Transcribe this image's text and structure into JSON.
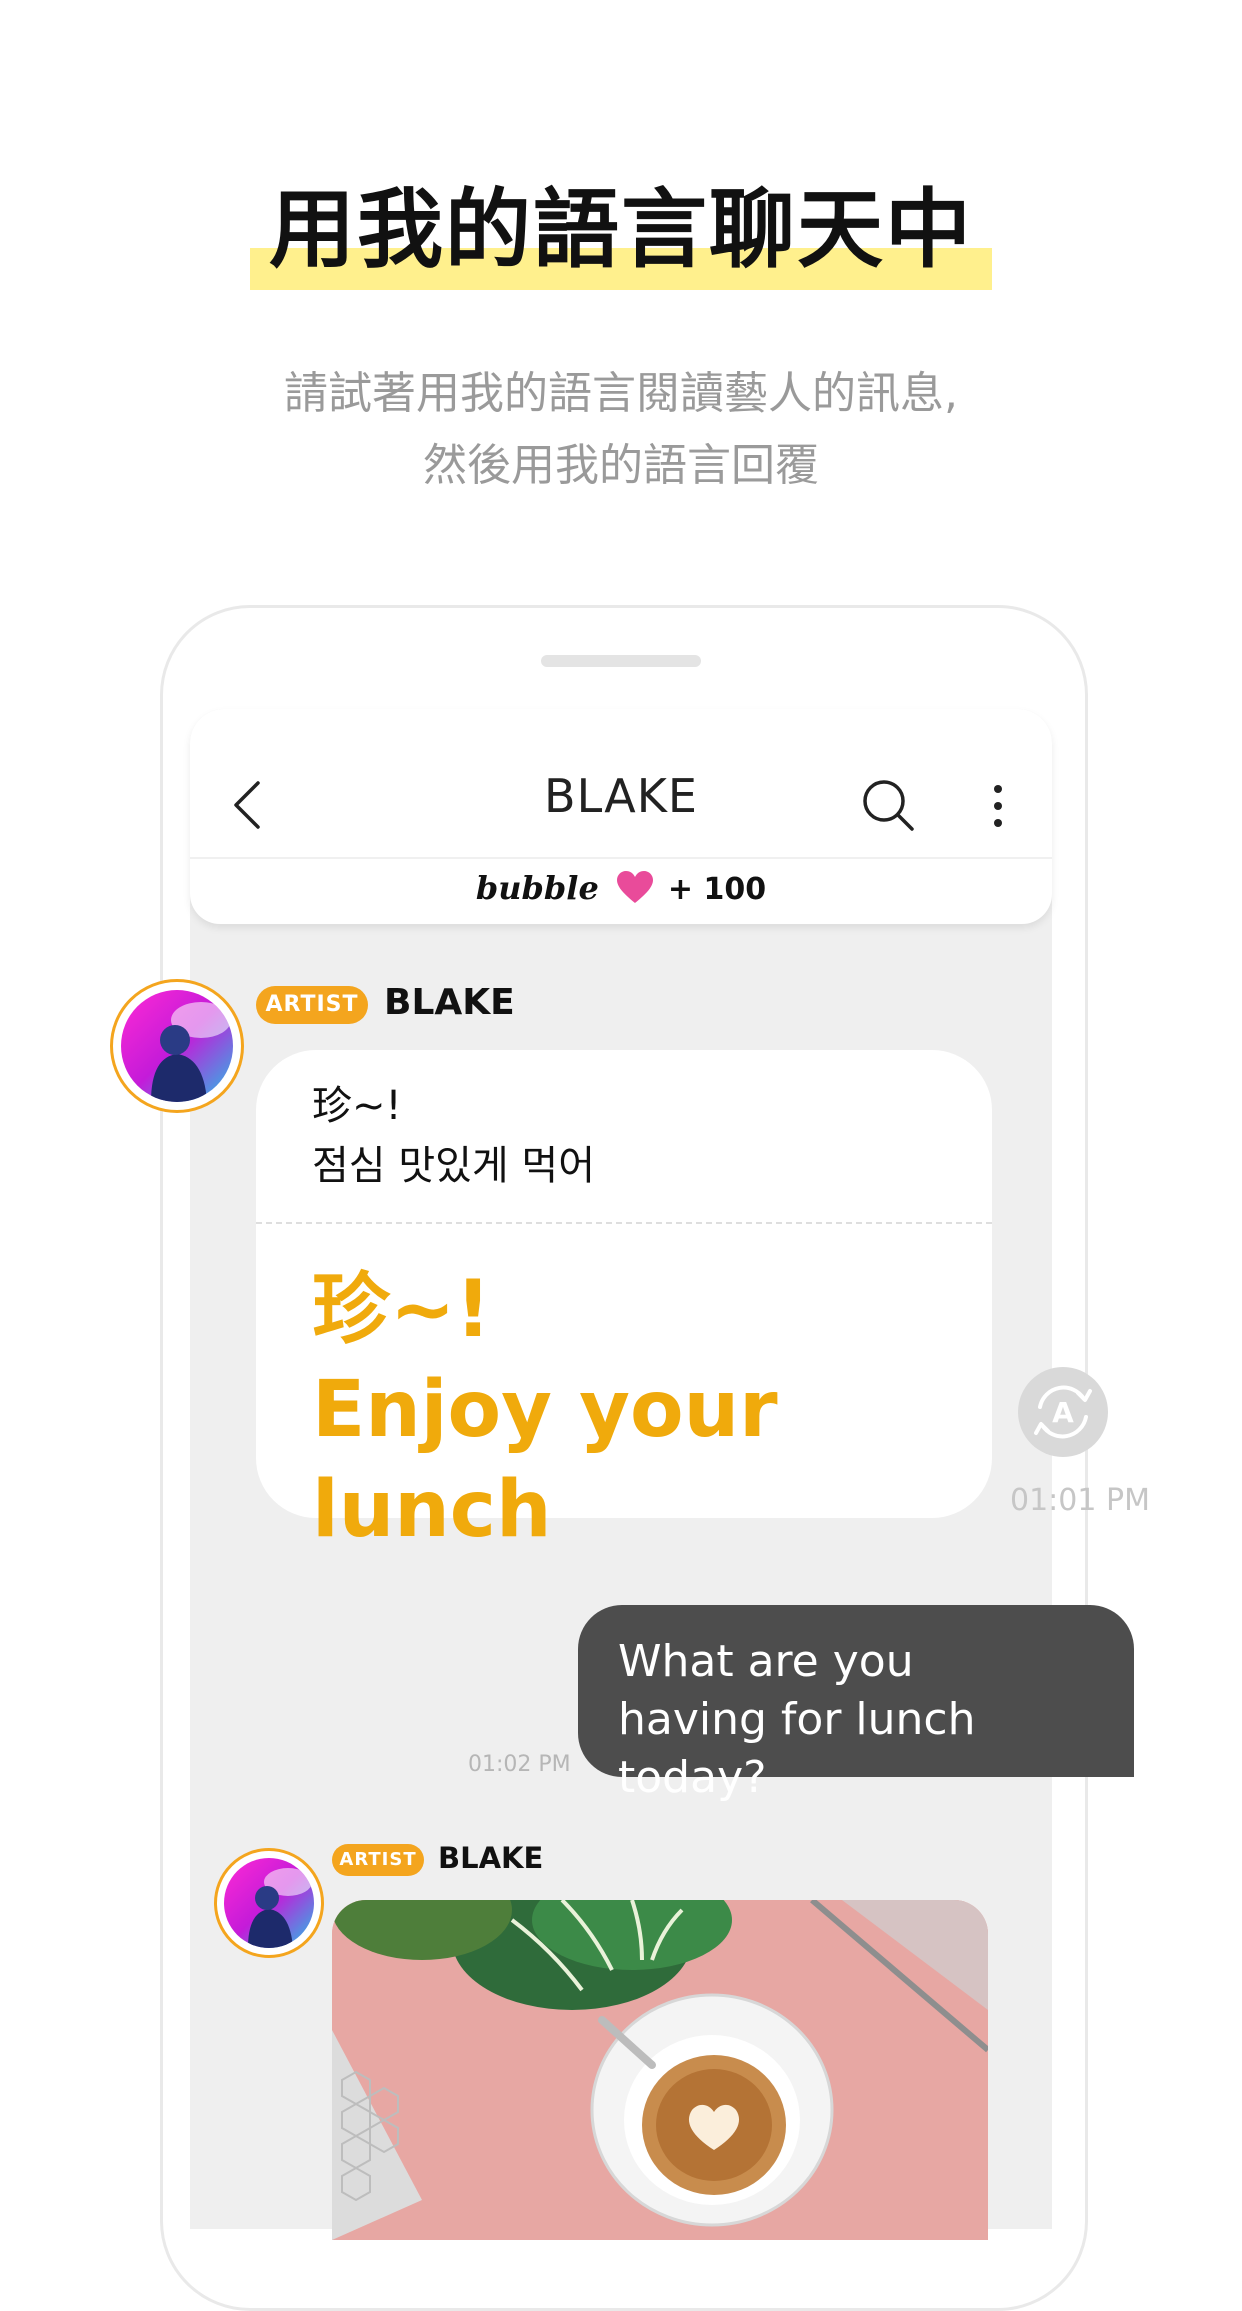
{
  "promo": {
    "headline": "用我的語言聊天中",
    "subtitle_line1": "請試著用我的語言閱讀藝人的訊息,",
    "subtitle_line2": "然後用我的語言回覆"
  },
  "chat_header": {
    "title": "BLAKE",
    "bubble_logo": "bubble",
    "points": "+ 100"
  },
  "messages": [
    {
      "badge": "ARTIST",
      "sender": "BLAKE",
      "original_line1": "珍~!",
      "original_line2": "점심 맛있게 먹어",
      "translated_line1": "珍~!",
      "translated_line2": "Enjoy your lunch",
      "time": "01:01 PM"
    },
    {
      "reply_line1": "What are you",
      "reply_line2": "having for lunch today?",
      "time": "01:02 PM"
    },
    {
      "badge": "ARTIST",
      "sender": "BLAKE"
    }
  ],
  "colors": {
    "accent_orange": "#f4a51e",
    "translated_text": "#f0aa0c",
    "highlight_yellow": "#fff08d",
    "reply_bubble": "#4d4d4d",
    "heart_pink": "#e94b9a"
  },
  "icons": {
    "back": "chevron-left-icon",
    "search": "search-icon",
    "more": "more-vertical-icon",
    "heart": "heart-icon",
    "translate": "translate-icon"
  }
}
